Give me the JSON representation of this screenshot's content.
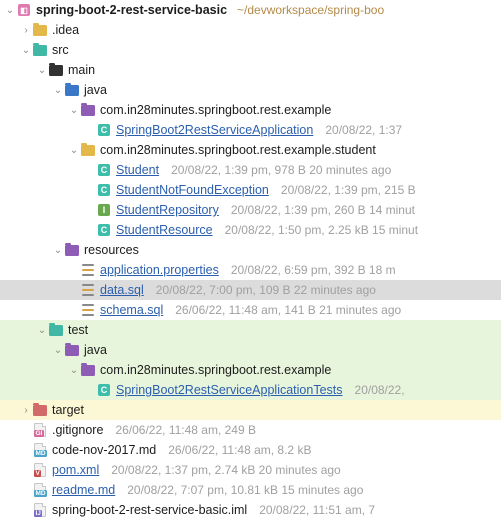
{
  "project": {
    "name": "spring-boot-2-rest-service-basic",
    "path_hint": "~/devworkspace/spring-boo"
  },
  "nodes": {
    "idea": ".idea",
    "src": "src",
    "main": "main",
    "java": "java",
    "pkg_example": "com.in28minutes.springboot.rest.example",
    "app_class": "SpringBoot2RestServiceApplication",
    "app_class_meta": "20/08/22, 1:37",
    "pkg_student": "com.in28minutes.springboot.rest.example.student",
    "student": "Student",
    "student_meta": "20/08/22, 1:39 pm, 978 B 20 minutes ago",
    "student_nfe": "StudentNotFoundException",
    "student_nfe_meta": "20/08/22, 1:39 pm, 215 B",
    "student_repo": "StudentRepository",
    "student_repo_meta": "20/08/22, 1:39 pm, 260 B 14 minut",
    "student_res": "StudentResource",
    "student_res_meta": "20/08/22, 1:50 pm, 2.25 kB 15 minut",
    "resources": "resources",
    "app_props": "application.properties",
    "app_props_meta": "20/08/22, 6:59 pm, 392 B 18 m",
    "data_sql": "data.sql",
    "data_sql_meta": "20/08/22, 7:00 pm, 109 B 22 minutes ago",
    "schema_sql": "schema.sql",
    "schema_sql_meta": "26/06/22, 11:48 am, 141 B 21 minutes ago",
    "test": "test",
    "java2": "java",
    "pkg_test": "com.in28minutes.springboot.rest.example",
    "test_class": "SpringBoot2RestServiceApplicationTests",
    "test_class_meta": "20/08/22,",
    "target": "target",
    "gitignore": ".gitignore",
    "gitignore_meta": "26/06/22, 11:48 am, 249 B",
    "code_md": "code-nov-2017.md",
    "code_md_meta": "26/06/22, 11:48 am, 8.2 kB",
    "pom": "pom.xml",
    "pom_meta": "20/08/22, 1:37 pm, 2.74 kB 20 minutes ago",
    "readme": "readme.md",
    "readme_meta": "20/08/22, 7:07 pm, 10.81 kB 15 minutes ago",
    "iml": "spring-boot-2-rest-service-basic.iml",
    "iml_meta": "20/08/22, 11:51 am, 7"
  }
}
